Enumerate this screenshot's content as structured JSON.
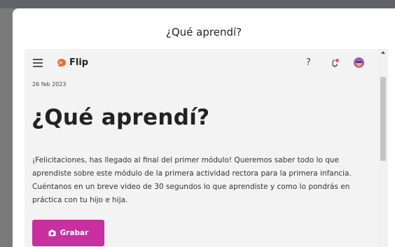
{
  "modal": {
    "title": "¿Qué aprendí?"
  },
  "header": {
    "app_name": "Flip",
    "help_label": "?"
  },
  "post": {
    "date": "26 feb 2023",
    "title": "¿Qué aprendí?",
    "lines": [
      "¡Felicitaciones, has llegado al final del primer módulo! Queremos saber todo lo que",
      "aprendiste sobre este módulo de la primera actividad rectora para la primera infancia.",
      "Cuéntanos en un breve video de 30 segundos lo que aprendiste y como lo pondrás en",
      "práctica con tu hijo e hija."
    ],
    "record_label": "Grabar"
  },
  "colors": {
    "accent": "#c7309e",
    "flip_logo": "#f06a3c",
    "notification_dot": "#e04ea0",
    "avatar": "#9b58d6"
  },
  "icons": [
    "menu-icon",
    "flip-logo-icon",
    "help-icon",
    "bell-icon",
    "avatar-icon",
    "camera-icon"
  ]
}
